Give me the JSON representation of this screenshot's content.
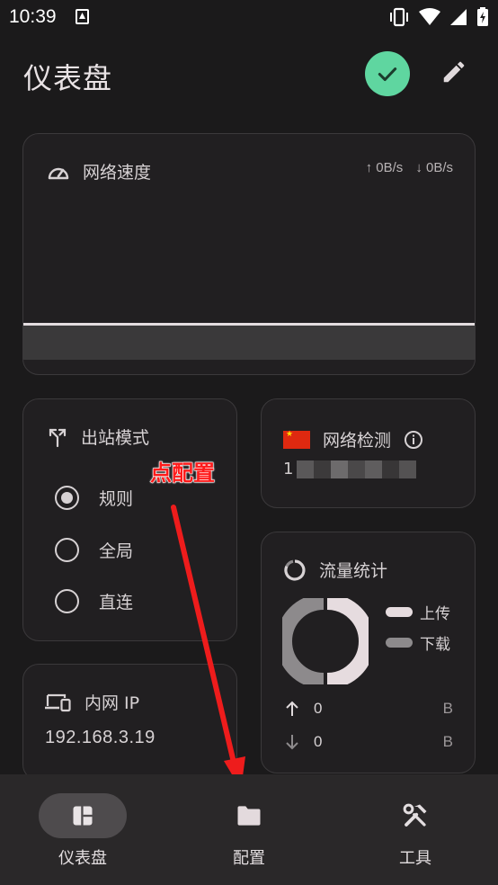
{
  "status_bar": {
    "time": "10:39",
    "icons": [
      "notification-icon",
      "vibrate-icon",
      "wifi-icon",
      "signal-icon",
      "battery-icon"
    ]
  },
  "header": {
    "title": "仪表盘",
    "status_icon": "check-icon",
    "edit_icon": "pencil-icon"
  },
  "speed_card": {
    "title": "网络速度",
    "icon": "speedometer-icon",
    "upload": "↑ 0B/s",
    "download": "↓ 0B/s"
  },
  "mode_card": {
    "title": "出站模式",
    "icon": "route-icon",
    "options": [
      {
        "label": "规则",
        "selected": true
      },
      {
        "label": "全局",
        "selected": false
      },
      {
        "label": "直连",
        "selected": false
      }
    ]
  },
  "netcheck_card": {
    "title": "网络检测",
    "flag_icon": "china-flag-icon",
    "info_icon": "info-icon",
    "ip_prefix": "1"
  },
  "traffic_card": {
    "title": "流量统计",
    "icon": "loading-ring-icon",
    "legend": [
      {
        "label": "上传",
        "color": "#e6dcdf"
      },
      {
        "label": "下载",
        "color": "#8d8a8c"
      }
    ],
    "upload_value": "0",
    "upload_unit": "B",
    "download_value": "0",
    "download_unit": "B"
  },
  "ip_card": {
    "title": "内网 IP",
    "icon": "devices-icon",
    "value": "192.168.3.19"
  },
  "annotation": {
    "text": "点配置",
    "color": "#ff1a1a"
  },
  "bottom_nav": {
    "items": [
      {
        "label": "仪表盘",
        "icon": "dashboard-icon",
        "active": true
      },
      {
        "label": "配置",
        "icon": "folder-icon",
        "active": false
      },
      {
        "label": "工具",
        "icon": "tools-icon",
        "active": false
      }
    ]
  },
  "colors": {
    "background": "#1b1a1b",
    "card": "#211f21",
    "accent_green": "#5fd6a0",
    "nav_bg": "#2a2829"
  }
}
